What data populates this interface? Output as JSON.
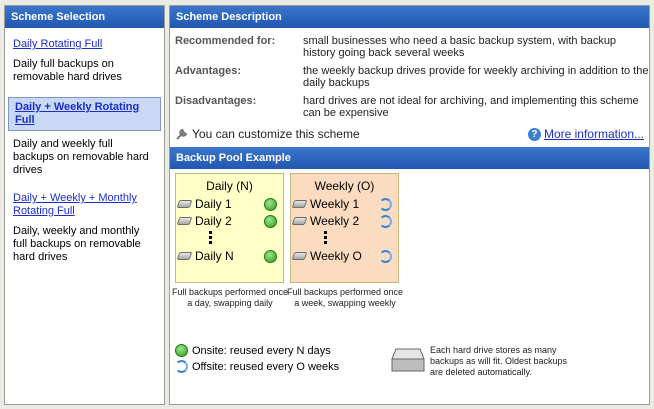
{
  "left": {
    "header": "Scheme Selection",
    "schemes": [
      {
        "label": "Daily Rotating Full",
        "desc": "Daily full backups on removable hard drives"
      },
      {
        "label": "Daily + Weekly Rotating Full",
        "desc": "Daily and weekly full backups on removable hard drives"
      },
      {
        "label": "Daily + Weekly + Monthly Rotating Full",
        "desc": "Daily, weekly and monthly full backups on removable hard drives"
      }
    ]
  },
  "description": {
    "header": "Scheme Description",
    "recommended_label": "Recommended for:",
    "recommended_text": "small businesses who need a basic backup system, with backup history going back several weeks",
    "advantages_label": "Advantages:",
    "advantages_text": "the weekly backup drives provide for weekly archiving in addition to the daily backups",
    "disadvantages_label": "Disadvantages:",
    "disadvantages_text": "hard drives are not ideal for archiving, and implementing this scheme can be expensive",
    "customize_text": "You can customize this scheme",
    "more_info": "More information..."
  },
  "pool": {
    "header": "Backup Pool Example",
    "daily": {
      "title": "Daily (N)",
      "items": [
        "Daily 1",
        "Daily 2",
        "Daily N"
      ],
      "caption": "Full backups performed once a day, swapping daily",
      "bg": "#ffffc8"
    },
    "weekly": {
      "title": "Weekly (O)",
      "items": [
        "Weekly 1",
        "Weekly 2",
        "Weekly O"
      ],
      "caption": "Full backups performed once a week, swapping weekly",
      "bg": "#fcdcc0"
    },
    "onsite": "Onsite: reused every N days",
    "offsite": "Offsite: reused every O weeks",
    "drive_note": "Each hard drive stores as many backups as will fit. Oldest backups are deleted automatically."
  }
}
